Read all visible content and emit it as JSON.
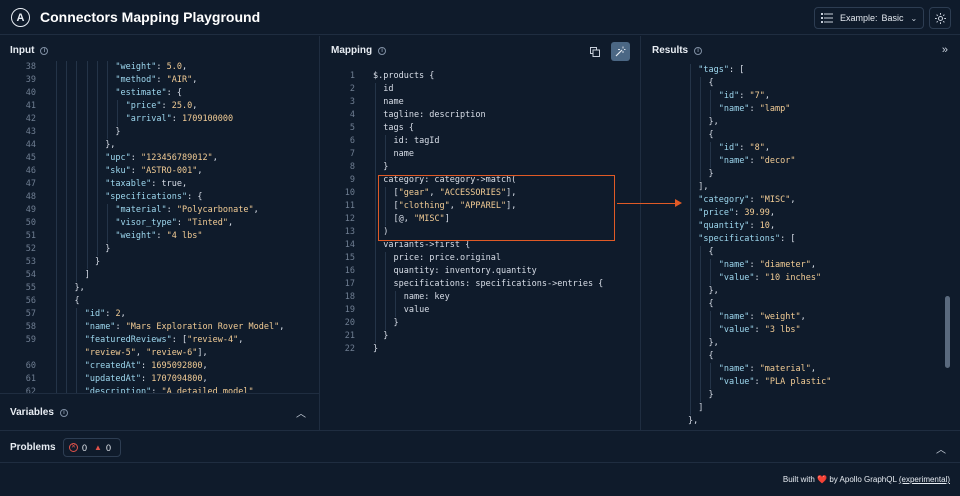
{
  "app": {
    "title": "Connectors Mapping Playground",
    "logo_glyph": "A"
  },
  "header": {
    "example_label": "Example:",
    "example_value": "Basic"
  },
  "input": {
    "title": "Input",
    "lines": [
      {
        "n": "38",
        "i": 4,
        "t": [
          [
            "k",
            "\"weight\""
          ],
          [
            "p",
            ": "
          ],
          [
            "n",
            "5.0"
          ],
          [
            "p",
            ","
          ]
        ]
      },
      {
        "n": "39",
        "i": 4,
        "t": [
          [
            "k",
            "\"method\""
          ],
          [
            "p",
            ": "
          ],
          [
            "s",
            "\"AIR\""
          ],
          [
            "p",
            ","
          ]
        ]
      },
      {
        "n": "40",
        "i": 4,
        "t": [
          [
            "k",
            "\"estimate\""
          ],
          [
            "p",
            ": {"
          ]
        ]
      },
      {
        "n": "41",
        "i": 5,
        "t": [
          [
            "k",
            "\"price\""
          ],
          [
            "p",
            ": "
          ],
          [
            "n",
            "25.0"
          ],
          [
            "p",
            ","
          ]
        ]
      },
      {
        "n": "42",
        "i": 5,
        "t": [
          [
            "k",
            "\"arrival\""
          ],
          [
            "p",
            ": "
          ],
          [
            "n",
            "1709100000"
          ]
        ]
      },
      {
        "n": "43",
        "i": 4,
        "t": [
          [
            "p",
            "}"
          ]
        ]
      },
      {
        "n": "44",
        "i": 3,
        "t": [
          [
            "p",
            "},"
          ]
        ]
      },
      {
        "n": "45",
        "i": 3,
        "t": [
          [
            "k",
            "\"upc\""
          ],
          [
            "p",
            ": "
          ],
          [
            "s",
            "\"123456789012\""
          ],
          [
            "p",
            ","
          ]
        ]
      },
      {
        "n": "46",
        "i": 3,
        "t": [
          [
            "k",
            "\"sku\""
          ],
          [
            "p",
            ": "
          ],
          [
            "s",
            "\"ASTRO-001\""
          ],
          [
            "p",
            ","
          ]
        ]
      },
      {
        "n": "47",
        "i": 3,
        "t": [
          [
            "k",
            "\"taxable\""
          ],
          [
            "p",
            ": true,"
          ]
        ]
      },
      {
        "n": "48",
        "i": 3,
        "t": [
          [
            "k",
            "\"specifications\""
          ],
          [
            "p",
            ": {"
          ]
        ]
      },
      {
        "n": "49",
        "i": 4,
        "t": [
          [
            "k",
            "\"material\""
          ],
          [
            "p",
            ": "
          ],
          [
            "s",
            "\"Polycarbonate\""
          ],
          [
            "p",
            ","
          ]
        ]
      },
      {
        "n": "50",
        "i": 4,
        "t": [
          [
            "k",
            "\"visor_type\""
          ],
          [
            "p",
            ": "
          ],
          [
            "s",
            "\"Tinted\""
          ],
          [
            "p",
            ","
          ]
        ]
      },
      {
        "n": "51",
        "i": 4,
        "t": [
          [
            "k",
            "\"weight\""
          ],
          [
            "p",
            ": "
          ],
          [
            "s",
            "\"4 lbs\""
          ]
        ]
      },
      {
        "n": "52",
        "i": 3,
        "t": [
          [
            "p",
            "}"
          ]
        ]
      },
      {
        "n": "53",
        "i": 2,
        "t": [
          [
            "p",
            "}"
          ]
        ]
      },
      {
        "n": "54",
        "i": 1,
        "t": [
          [
            "p",
            "]"
          ]
        ]
      },
      {
        "n": "55",
        "i": 0,
        "t": [
          [
            "p",
            "},"
          ]
        ]
      },
      {
        "n": "56",
        "i": 0,
        "t": [
          [
            "p",
            "{"
          ]
        ]
      },
      {
        "n": "57",
        "i": 1,
        "t": [
          [
            "k",
            "\"id\""
          ],
          [
            "p",
            ": "
          ],
          [
            "n",
            "2"
          ],
          [
            "p",
            ","
          ]
        ]
      },
      {
        "n": "58",
        "i": 1,
        "t": [
          [
            "k",
            "\"name\""
          ],
          [
            "p",
            ": "
          ],
          [
            "s",
            "\"Mars Exploration Rover Model\""
          ],
          [
            "p",
            ","
          ]
        ]
      },
      {
        "n": "59",
        "i": 1,
        "t": [
          [
            "k",
            "\"featuredReviews\""
          ],
          [
            "p",
            ": ["
          ],
          [
            "s",
            "\"review-4\""
          ],
          [
            "p",
            ","
          ]
        ]
      },
      {
        "n": "",
        "i": 1,
        "t": [
          [
            "s",
            "\"review-5\""
          ],
          [
            "p",
            ", "
          ],
          [
            "s",
            "\"review-6\""
          ],
          [
            "p",
            "],"
          ]
        ]
      },
      {
        "n": "60",
        "i": 1,
        "t": [
          [
            "k",
            "\"createdAt\""
          ],
          [
            "p",
            ": "
          ],
          [
            "n",
            "1695092800"
          ],
          [
            "p",
            ","
          ]
        ]
      },
      {
        "n": "61",
        "i": 1,
        "t": [
          [
            "k",
            "\"updatedAt\""
          ],
          [
            "p",
            ": "
          ],
          [
            "n",
            "1707094800"
          ],
          [
            "p",
            ","
          ]
        ]
      },
      {
        "n": "62",
        "i": 1,
        "t": [
          [
            "k",
            "\"description\""
          ],
          [
            "p",
            ": "
          ],
          [
            "s",
            "\"A detailed model\""
          ]
        ]
      }
    ]
  },
  "variables": {
    "title": "Variables"
  },
  "mapping": {
    "title": "Mapping",
    "lines": [
      {
        "n": "1",
        "i": 0,
        "t": [
          [
            "p",
            "$.products {"
          ]
        ]
      },
      {
        "n": "2",
        "i": 1,
        "t": [
          [
            "p",
            "id"
          ]
        ]
      },
      {
        "n": "3",
        "i": 1,
        "t": [
          [
            "p",
            "name"
          ]
        ]
      },
      {
        "n": "4",
        "i": 1,
        "t": [
          [
            "p",
            "tagline: description"
          ]
        ]
      },
      {
        "n": "5",
        "i": 1,
        "t": [
          [
            "p",
            "tags {"
          ]
        ]
      },
      {
        "n": "6",
        "i": 2,
        "t": [
          [
            "p",
            "id: tagId"
          ]
        ]
      },
      {
        "n": "7",
        "i": 2,
        "t": [
          [
            "p",
            "name"
          ]
        ]
      },
      {
        "n": "8",
        "i": 1,
        "t": [
          [
            "p",
            "}"
          ]
        ]
      },
      {
        "n": "9",
        "i": 1,
        "t": [
          [
            "p",
            "category: category->match("
          ]
        ]
      },
      {
        "n": "10",
        "i": 2,
        "t": [
          [
            "p",
            "["
          ],
          [
            "s",
            "\"gear\""
          ],
          [
            "p",
            ", "
          ],
          [
            "s",
            "\"ACCESSORIES\""
          ],
          [
            "p",
            "],"
          ]
        ]
      },
      {
        "n": "11",
        "i": 2,
        "t": [
          [
            "p",
            "["
          ],
          [
            "s",
            "\"clothing\""
          ],
          [
            "p",
            ", "
          ],
          [
            "s",
            "\"APPAREL\""
          ],
          [
            "p",
            "],"
          ]
        ]
      },
      {
        "n": "12",
        "i": 2,
        "t": [
          [
            "p",
            "[@, "
          ],
          [
            "s",
            "\"MISC\""
          ],
          [
            "p",
            "]"
          ]
        ]
      },
      {
        "n": "13",
        "i": 1,
        "t": [
          [
            "p",
            ")"
          ]
        ]
      },
      {
        "n": "14",
        "i": 1,
        "t": [
          [
            "p",
            "variants->first {"
          ]
        ]
      },
      {
        "n": "15",
        "i": 2,
        "t": [
          [
            "p",
            "price: price.original"
          ]
        ]
      },
      {
        "n": "16",
        "i": 2,
        "t": [
          [
            "p",
            "quantity: inventory.quantity"
          ]
        ]
      },
      {
        "n": "17",
        "i": 2,
        "t": [
          [
            "p",
            "specifications: specifications->entries {"
          ]
        ]
      },
      {
        "n": "18",
        "i": 3,
        "t": [
          [
            "p",
            "name: key"
          ]
        ]
      },
      {
        "n": "19",
        "i": 3,
        "t": [
          [
            "p",
            "value"
          ]
        ]
      },
      {
        "n": "20",
        "i": 2,
        "t": [
          [
            "p",
            "}"
          ]
        ]
      },
      {
        "n": "21",
        "i": 1,
        "t": [
          [
            "p",
            "}"
          ]
        ]
      },
      {
        "n": "22",
        "i": 0,
        "t": [
          [
            "p",
            "}"
          ]
        ]
      }
    ]
  },
  "results": {
    "title": "Results",
    "lines": [
      {
        "i": 0,
        "t": [
          [
            "k",
            "\"tags\""
          ],
          [
            "p",
            ": ["
          ]
        ]
      },
      {
        "i": 1,
        "t": [
          [
            "p",
            "{"
          ]
        ]
      },
      {
        "i": 2,
        "t": [
          [
            "k",
            "\"id\""
          ],
          [
            "p",
            ": "
          ],
          [
            "s",
            "\"7\""
          ],
          [
            "p",
            ","
          ]
        ]
      },
      {
        "i": 2,
        "t": [
          [
            "k",
            "\"name\""
          ],
          [
            "p",
            ": "
          ],
          [
            "s",
            "\"lamp\""
          ]
        ]
      },
      {
        "i": 1,
        "t": [
          [
            "p",
            "},"
          ]
        ]
      },
      {
        "i": 1,
        "t": [
          [
            "p",
            "{"
          ]
        ]
      },
      {
        "i": 2,
        "t": [
          [
            "k",
            "\"id\""
          ],
          [
            "p",
            ": "
          ],
          [
            "s",
            "\"8\""
          ],
          [
            "p",
            ","
          ]
        ]
      },
      {
        "i": 2,
        "t": [
          [
            "k",
            "\"name\""
          ],
          [
            "p",
            ": "
          ],
          [
            "s",
            "\"decor\""
          ]
        ]
      },
      {
        "i": 1,
        "t": [
          [
            "p",
            "}"
          ]
        ]
      },
      {
        "i": 0,
        "t": [
          [
            "p",
            "],"
          ]
        ]
      },
      {
        "i": 0,
        "t": [
          [
            "k",
            "\"category\""
          ],
          [
            "p",
            ": "
          ],
          [
            "s",
            "\"MISC\""
          ],
          [
            "p",
            ","
          ]
        ]
      },
      {
        "i": 0,
        "t": [
          [
            "k",
            "\"price\""
          ],
          [
            "p",
            ": "
          ],
          [
            "n",
            "39.99"
          ],
          [
            "p",
            ","
          ]
        ]
      },
      {
        "i": 0,
        "t": [
          [
            "k",
            "\"quantity\""
          ],
          [
            "p",
            ": "
          ],
          [
            "n",
            "10"
          ],
          [
            "p",
            ","
          ]
        ]
      },
      {
        "i": 0,
        "t": [
          [
            "k",
            "\"specifications\""
          ],
          [
            "p",
            ": ["
          ]
        ]
      },
      {
        "i": 1,
        "t": [
          [
            "p",
            "{"
          ]
        ]
      },
      {
        "i": 2,
        "t": [
          [
            "k",
            "\"name\""
          ],
          [
            "p",
            ": "
          ],
          [
            "s",
            "\"diameter\""
          ],
          [
            "p",
            ","
          ]
        ]
      },
      {
        "i": 2,
        "t": [
          [
            "k",
            "\"value\""
          ],
          [
            "p",
            ": "
          ],
          [
            "s",
            "\"10 inches\""
          ]
        ]
      },
      {
        "i": 1,
        "t": [
          [
            "p",
            "},"
          ]
        ]
      },
      {
        "i": 1,
        "t": [
          [
            "p",
            "{"
          ]
        ]
      },
      {
        "i": 2,
        "t": [
          [
            "k",
            "\"name\""
          ],
          [
            "p",
            ": "
          ],
          [
            "s",
            "\"weight\""
          ],
          [
            "p",
            ","
          ]
        ]
      },
      {
        "i": 2,
        "t": [
          [
            "k",
            "\"value\""
          ],
          [
            "p",
            ": "
          ],
          [
            "s",
            "\"3 lbs\""
          ]
        ]
      },
      {
        "i": 1,
        "t": [
          [
            "p",
            "},"
          ]
        ]
      },
      {
        "i": 1,
        "t": [
          [
            "p",
            "{"
          ]
        ]
      },
      {
        "i": 2,
        "t": [
          [
            "k",
            "\"name\""
          ],
          [
            "p",
            ": "
          ],
          [
            "s",
            "\"material\""
          ],
          [
            "p",
            ","
          ]
        ]
      },
      {
        "i": 2,
        "t": [
          [
            "k",
            "\"value\""
          ],
          [
            "p",
            ": "
          ],
          [
            "s",
            "\"PLA plastic\""
          ]
        ]
      },
      {
        "i": 1,
        "t": [
          [
            "p",
            "}"
          ]
        ]
      },
      {
        "i": 0,
        "t": [
          [
            "p",
            "]"
          ]
        ]
      },
      {
        "i": -1,
        "t": [
          [
            "p",
            "},"
          ]
        ]
      }
    ]
  },
  "problems": {
    "title": "Problems",
    "errors": "0",
    "warnings": "0"
  },
  "footer": {
    "prefix": "Built with",
    "heart": "❤️",
    "by": "by Apollo GraphQL",
    "link": "(experimental)"
  },
  "colors": {
    "background": "#0f1b2b",
    "highlight": "#e05a26",
    "key": "#9ed8ef",
    "string": "#f2cc95"
  }
}
